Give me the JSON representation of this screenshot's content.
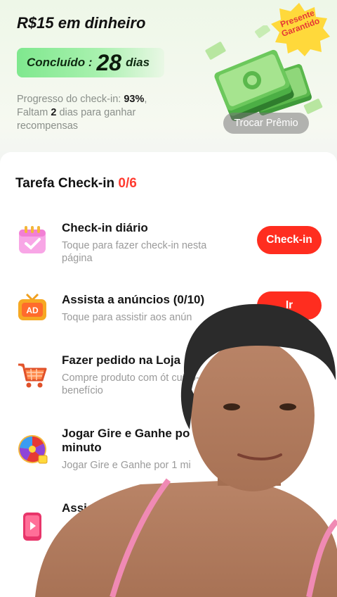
{
  "header": {
    "title": "R$15 em dinheiro",
    "completed_label": "Concluído :",
    "completed_days": "28",
    "completed_unit": "dias",
    "progress_prefix": "Progresso do check-in: ",
    "progress_percent": "93%",
    "progress_mid": ", Faltam ",
    "progress_days": "2",
    "progress_suffix": " dias para ganhar recompensas",
    "badge_line1": "Presente",
    "badge_line2": "Garantido",
    "trade_button": "Trocar Prêmio"
  },
  "tasks": {
    "title": "Tarefa Check-in ",
    "count": "0/6",
    "items": [
      {
        "icon": "calendar-check-icon",
        "name": "Check-in diário",
        "desc": "Toque para fazer check-in nesta página",
        "button": "Check-in"
      },
      {
        "icon": "ad-tv-icon",
        "name": "Assista a anúncios  (0/10)",
        "desc": "Toque para assistir aos anún",
        "button": "Ir"
      },
      {
        "icon": "shopping-cart-icon",
        "name": "Fazer pedido na Loja",
        "desc": "Compre produto com ót custo-benefício"
      },
      {
        "icon": "spin-wheel-icon",
        "name": "Jogar Gire e Ganhe po minuto",
        "desc": "Jogar Gire e Ganhe por 1 mi"
      },
      {
        "icon": "video-phone-icon",
        "name": "Assista a víde mi",
        "desc": ""
      }
    ]
  },
  "colors": {
    "accent": "#ff2d1f",
    "pill_green": "#7fe88e",
    "badge_yellow": "#ffd93b"
  }
}
